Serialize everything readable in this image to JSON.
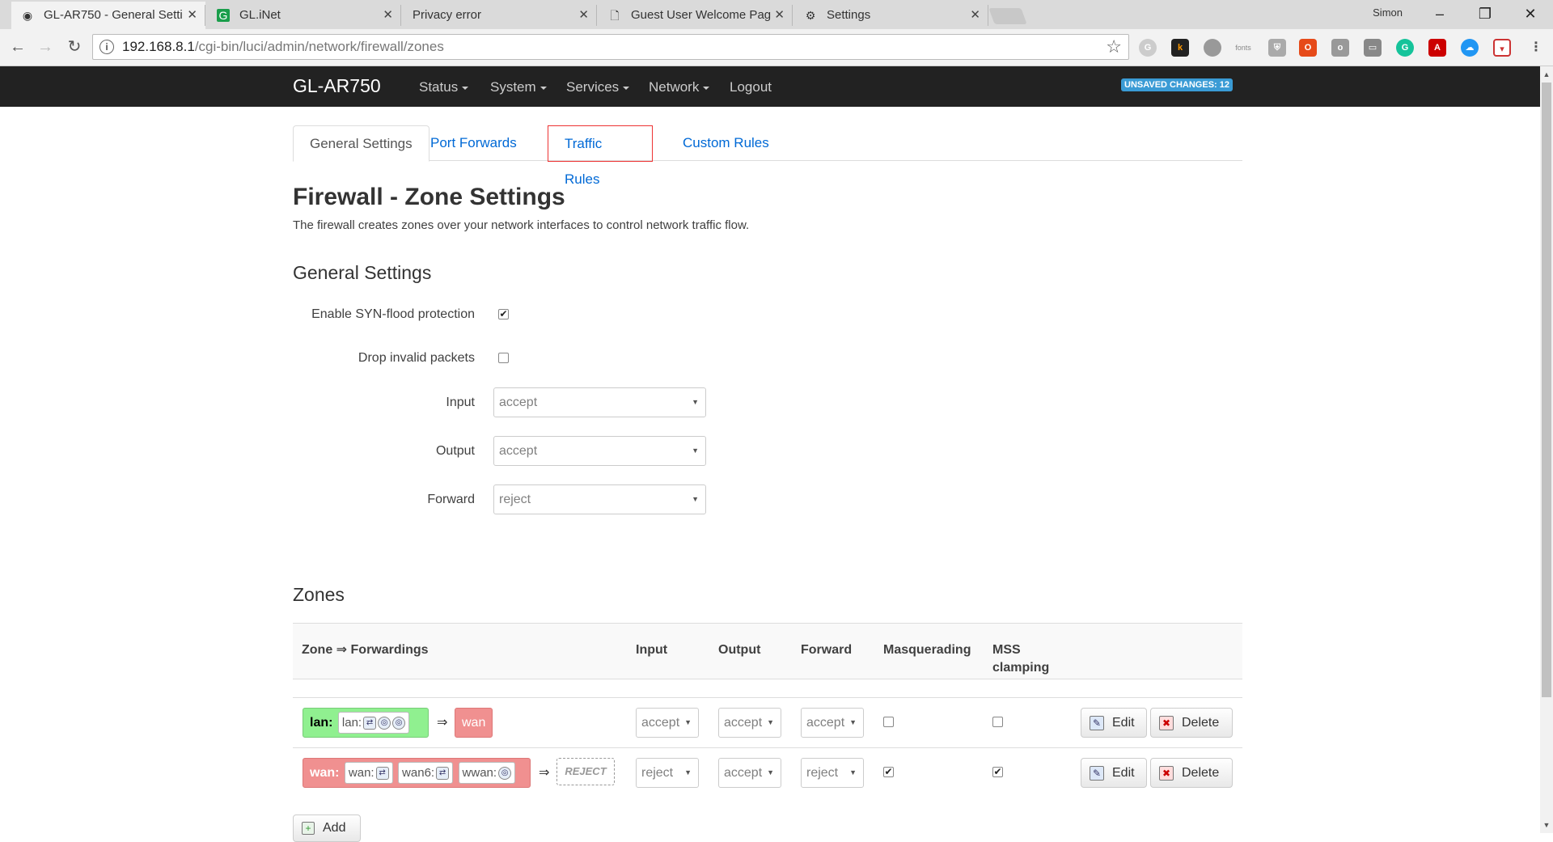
{
  "browser": {
    "tabs": [
      {
        "title": "GL-AR750 - General Setti",
        "icon": "router-icon",
        "active": true
      },
      {
        "title": "GL.iNet",
        "icon": "glinet-icon",
        "active": false
      },
      {
        "title": "Privacy error",
        "icon": "none",
        "active": false
      },
      {
        "title": "Guest User Welcome Pag",
        "icon": "page-icon",
        "active": false
      },
      {
        "title": "Settings",
        "icon": "gear-icon",
        "active": false
      }
    ],
    "profile": "Simon",
    "url_host": "192.168.8.1",
    "url_path": "/cgi-bin/luci/admin/network/firewall/zones",
    "window_controls": [
      "–",
      "❐",
      "✕"
    ]
  },
  "header": {
    "brand": "GL-AR750",
    "menu": [
      "Status",
      "System",
      "Services",
      "Network",
      "Logout"
    ],
    "unsaved": "UNSAVED CHANGES: 12"
  },
  "tabs": [
    "General Settings",
    "Port Forwards",
    "Traffic Rules",
    "Custom Rules"
  ],
  "page": {
    "title": "Firewall - Zone Settings",
    "description": "The firewall creates zones over your network interfaces to control network traffic flow.",
    "general_heading": "General Settings"
  },
  "general": {
    "syn_label": "Enable SYN-flood protection",
    "syn_checked": true,
    "drop_label": "Drop invalid packets",
    "drop_checked": false,
    "input_label": "Input",
    "input_value": "accept",
    "output_label": "Output",
    "output_value": "accept",
    "forward_label": "Forward",
    "forward_value": "reject"
  },
  "zones": {
    "heading": "Zones",
    "columns": [
      "Zone ⇒ Forwardings",
      "Input",
      "Output",
      "Forward",
      "Masquerading",
      "MSS",
      "clamping"
    ],
    "rows": [
      {
        "zone": "lan:",
        "networks": [
          "lan:"
        ],
        "arrow": "⇒",
        "dest": "wan",
        "input": "accept",
        "output": "accept",
        "forward": "accept",
        "masq": false,
        "mss": false
      },
      {
        "zone": "wan:",
        "networks": [
          "wan:",
          "wan6:",
          "wwan:"
        ],
        "arrow": "⇒",
        "dest": "REJECT",
        "input": "reject",
        "output": "accept",
        "forward": "reject",
        "masq": true,
        "mss": true
      }
    ],
    "edit_label": "Edit",
    "delete_label": "Delete",
    "add_label": "Add"
  },
  "colors": {
    "lan_green": "#90f090",
    "wan_red": "#f09090",
    "header_bg": "#222222",
    "link_blue": "#0069d6",
    "highlight_red": "#ee3333"
  }
}
